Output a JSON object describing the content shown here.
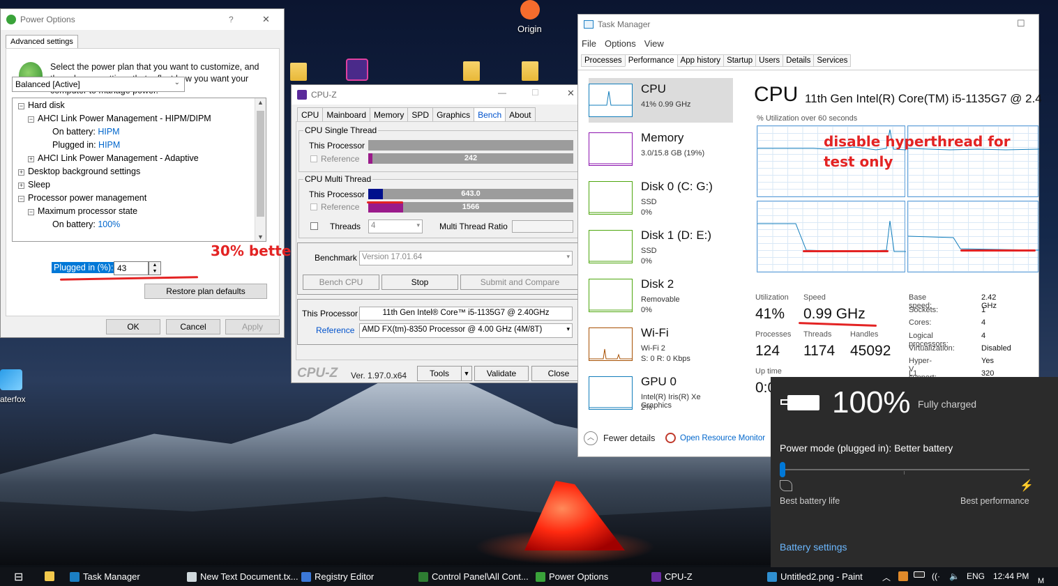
{
  "desktop": {
    "origin_label": "Origin",
    "waterfox_label": "aterfox",
    "partial_label_1": "ce",
    "partial_label_2": "M"
  },
  "power_options": {
    "title": "Power Options",
    "help": "?",
    "close": "✕",
    "tab": "Advanced settings",
    "description": "Select the power plan that you want to customize, and then choose settings that reflect how you want your computer to manage power.",
    "plan": "Balanced [Active]",
    "tree": [
      {
        "label": "Hard disk",
        "toggle": "−",
        "indent": 0
      },
      {
        "label": "AHCI Link Power Management - HIPM/DIPM",
        "toggle": "−",
        "indent": 1
      },
      {
        "label": "On battery:",
        "value": "HIPM",
        "indent": 2
      },
      {
        "label": "Plugged in:",
        "value": "HIPM",
        "indent": 2
      },
      {
        "label": "AHCI Link Power Management - Adaptive",
        "toggle": "+",
        "indent": 1
      },
      {
        "label": "Desktop background settings",
        "toggle": "+",
        "indent": 0
      },
      {
        "label": "Sleep",
        "toggle": "+",
        "indent": 0
      },
      {
        "label": "Processor power management",
        "toggle": "−",
        "indent": 0
      },
      {
        "label": "Maximum processor state",
        "toggle": "−",
        "indent": 1
      },
      {
        "label": "On battery:",
        "value": "100%",
        "indent": 2
      }
    ],
    "plugged_label": "Plugged in (%):",
    "plugged_value": "43",
    "restore_button": "Restore plan defaults",
    "ok": "OK",
    "cancel": "Cancel",
    "apply": "Apply"
  },
  "annotations": {
    "better": "30% better",
    "hyperthread_line1": "disable hyperthread for",
    "hyperthread_line2": "test only"
  },
  "cpuz": {
    "title": "CPU-Z",
    "tabs": [
      "CPU",
      "Mainboard",
      "Memory",
      "SPD",
      "Graphics",
      "Bench",
      "About"
    ],
    "active_tab": "Bench",
    "single_thread": {
      "title": "CPU Single Thread",
      "this_label": "This Processor",
      "this_fraction": 0,
      "ref_label": "Reference",
      "ref_value": "242",
      "ref_fraction": 0.02
    },
    "multi_thread": {
      "title": "CPU Multi Thread",
      "this_label": "This Processor",
      "this_value": "643.0",
      "this_fraction": 0.07,
      "ref_label": "Reference",
      "ref_value": "1566",
      "ref_fraction": 0.17
    },
    "threads_label": "Threads",
    "threads_value": "4",
    "ratio_label": "Multi Thread Ratio",
    "benchmark_label": "Benchmark",
    "benchmark_version": "Version 17.01.64",
    "bench_cpu": "Bench CPU",
    "stop": "Stop",
    "submit": "Submit and Compare",
    "this_processor_label": "This Processor",
    "this_processor_value": "11th Gen Intel® Core™ i5-1135G7 @ 2.40GHz",
    "reference_label": "Reference",
    "reference_value": "AMD FX(tm)-8350 Processor @ 4.00 GHz (4M/8T)",
    "logo": "CPU-Z",
    "version": "Ver. 1.97.0.x64",
    "tools": "Tools",
    "validate": "Validate",
    "close": "Close",
    "colors": {
      "this": "#00108c",
      "ref": "#9a1a8a"
    }
  },
  "task_manager": {
    "title": "Task Manager",
    "menu": [
      "File",
      "Options",
      "View"
    ],
    "tabs": [
      "Processes",
      "Performance",
      "App history",
      "Startup",
      "Users",
      "Details",
      "Services"
    ],
    "active_tab": "Performance",
    "sidebar": [
      {
        "name": "CPU",
        "sub1": "41%  0.99 GHz",
        "sub2": "",
        "sub3": "",
        "color": "#117dbb"
      },
      {
        "name": "Memory",
        "sub1": "3.0/15.8 GB (19%)",
        "sub2": "",
        "sub3": "",
        "color": "#8b12ae"
      },
      {
        "name": "Disk 0 (C: G:)",
        "sub1": "SSD",
        "sub2": "0%",
        "sub3": "",
        "color": "#4da60c"
      },
      {
        "name": "Disk 1 (D: E:)",
        "sub1": "SSD",
        "sub2": "0%",
        "sub3": "",
        "color": "#4da60c"
      },
      {
        "name": "Disk 2",
        "sub1": "Removable",
        "sub2": "0%",
        "sub3": "",
        "color": "#4da60c"
      },
      {
        "name": "Wi-Fi",
        "sub1": "Wi-Fi 2",
        "sub2": "S: 0  R: 0 Kbps",
        "sub3": "",
        "color": "#a74f01"
      },
      {
        "name": "GPU 0",
        "sub1": "Intel(R) Iris(R) Xe Graphics",
        "sub2": "2%",
        "sub3": "",
        "color": "#117dbb"
      }
    ],
    "cpu_title": "CPU",
    "cpu_name": "11th Gen Intel(R) Core(TM) i5-1135G7 @ 2.4",
    "graph_caption": "% Utilization over 60 seconds",
    "stats": {
      "utilization_label": "Utilization",
      "utilization": "41%",
      "speed_label": "Speed",
      "speed": "0.99 GHz",
      "processes_label": "Processes",
      "processes": "124",
      "threads_label": "Threads",
      "threads": "1174",
      "handles_label": "Handles",
      "handles": "45092",
      "uptime_label": "Up time",
      "uptime": "0:0"
    },
    "info": [
      {
        "label": "Base speed:",
        "value": "2.42 GHz"
      },
      {
        "label": "Sockets:",
        "value": "1"
      },
      {
        "label": "Cores:",
        "value": "4"
      },
      {
        "label": "Logical processors:",
        "value": "4"
      },
      {
        "label": "Virtualization:",
        "value": "Disabled"
      },
      {
        "label": "Hyper-V support:",
        "value": "Yes"
      },
      {
        "label": "L1 cache:",
        "value": "320 KB"
      }
    ],
    "fewer_details": "Fewer details",
    "resource_monitor": "Open Resource Monitor"
  },
  "battery": {
    "percent": "100%",
    "status": "Fully charged",
    "mode": "Power mode (plugged in): Better battery",
    "slider_level": 0,
    "left_label": "Best battery life",
    "right_label": "Best performance",
    "settings": "Battery settings"
  },
  "taskbar": {
    "items": [
      "Task Manager",
      "New Text Document.tx...",
      "Registry Editor",
      "Control Panel\\All Cont...",
      "Power Options",
      "CPU-Z",
      "Untitled2.png - Paint"
    ],
    "language": "ENG",
    "time": "12:44 PM"
  }
}
